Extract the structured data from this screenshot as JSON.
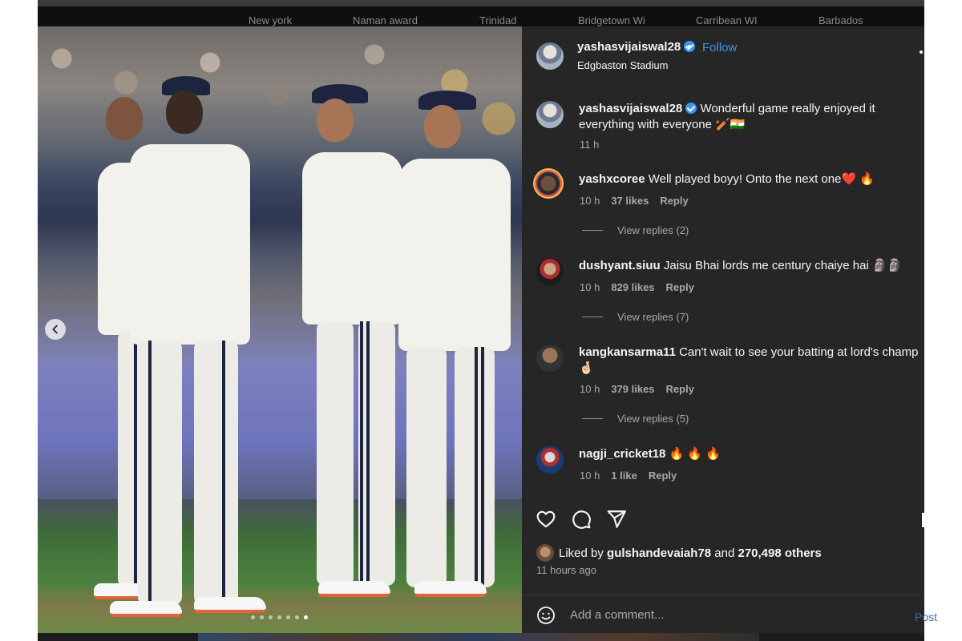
{
  "story_bar": {
    "labels": [
      "New york",
      "Naman award",
      "Trinidad",
      "Bridgetown Wi",
      "Carribean WI",
      "Barbados"
    ]
  },
  "post": {
    "username": "yashasvijaiswal28",
    "separator": "•",
    "follow_label": "Follow",
    "location": "Edgbaston Stadium",
    "caption": "Wonderful game really enjoyed it everything with everyone 🏏🇮🇳",
    "caption_time": "11 h",
    "carousel_count": 7,
    "carousel_active": 7
  },
  "comments": [
    {
      "username": "yashxcoree",
      "text": "Well played boyy! Onto the next one❤️ 🔥",
      "time": "10 h",
      "likes": "37 likes",
      "reply_label": "Reply",
      "view_replies": "View replies (2)"
    },
    {
      "username": "dushyant.siuu",
      "text": "Jaisu Bhai lords me century chaiye hai 🗿🗿",
      "time": "10 h",
      "likes": "829 likes",
      "reply_label": "Reply",
      "view_replies": "View replies (7)"
    },
    {
      "username": "kangkansarma11",
      "text": "Can't wait to see your batting at lord's champ 🤞🏻",
      "time": "10 h",
      "likes": "379 likes",
      "reply_label": "Reply",
      "view_replies": "View replies (5)"
    },
    {
      "username": "nagji_cricket18",
      "text": "🔥 🔥 🔥",
      "time": "10 h",
      "likes": "1 like",
      "reply_label": "Reply"
    }
  ],
  "engagement": {
    "liked_by_prefix": "Liked by",
    "liked_by_user": "gulshandevaiah78",
    "liked_by_and": "and",
    "liked_by_others": "270,498 others",
    "time_ago": "11 hours ago"
  },
  "comment_box": {
    "placeholder": "Add a comment...",
    "post_label": "Post"
  },
  "icons": [
    "chevron-left-icon",
    "heart-icon",
    "comment-icon",
    "share-icon",
    "emoji-icon",
    "verified-icon",
    "more-icon"
  ],
  "colors": {
    "panel_bg": "#262626",
    "link_blue": "#3897f0",
    "muted": "#a8a8a8"
  }
}
